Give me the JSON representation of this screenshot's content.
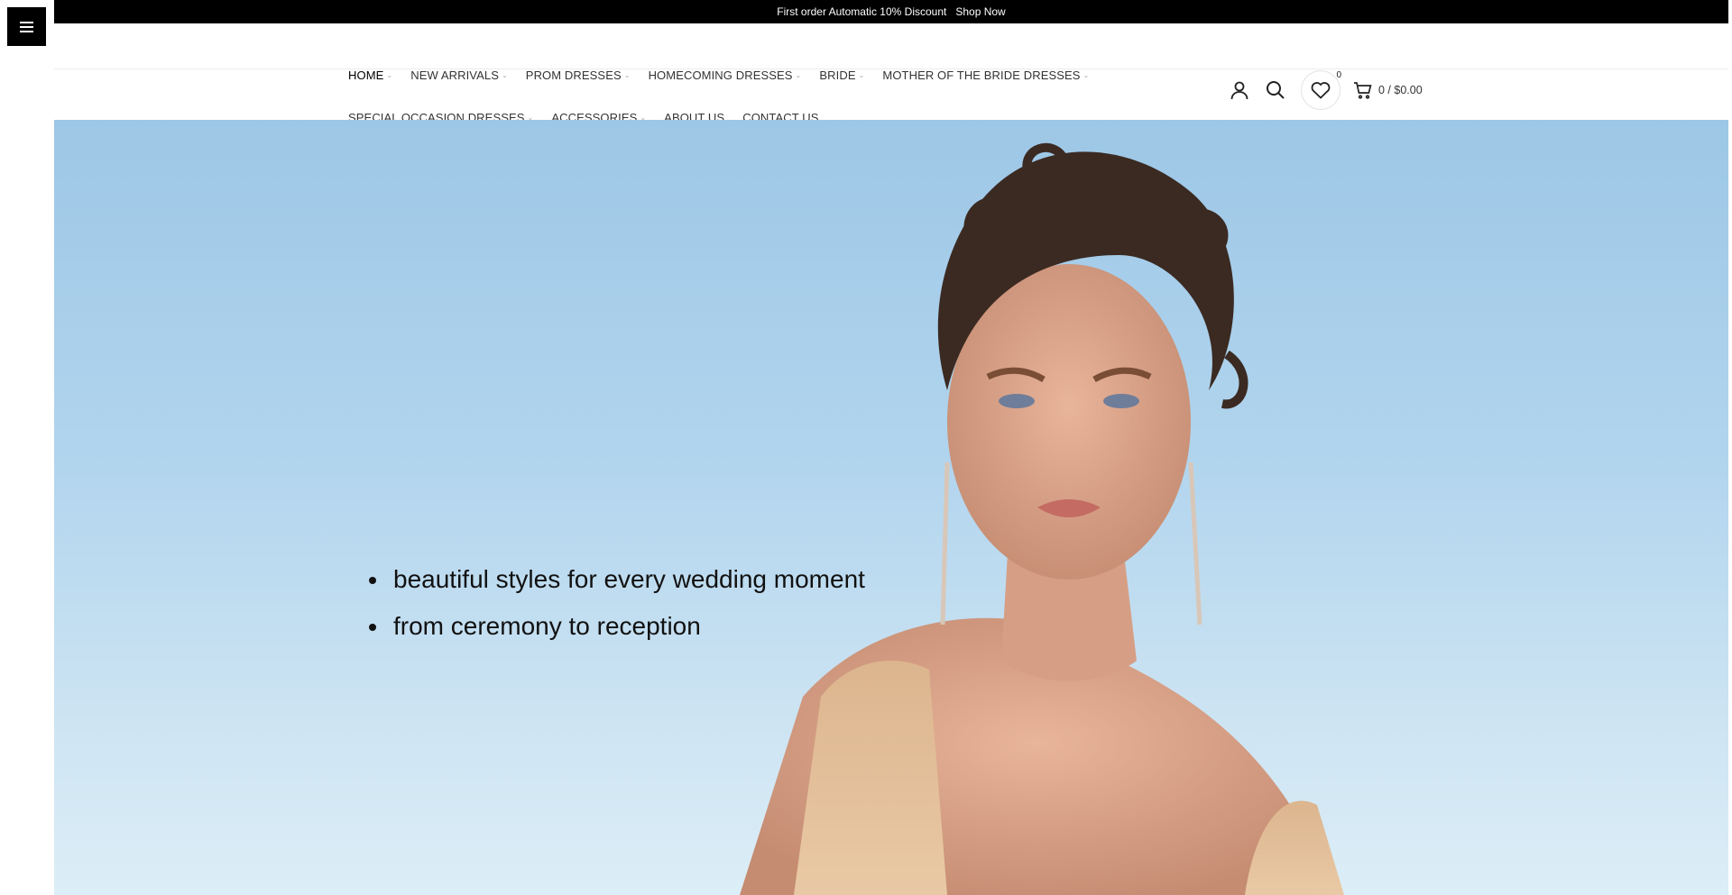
{
  "promo": {
    "text": "First order Automatic 10% Discount",
    "link": "Shop Now"
  },
  "nav": {
    "row1": [
      {
        "label": "HOME",
        "has_dropdown": true,
        "active": true
      },
      {
        "label": "NEW ARRIVALS",
        "has_dropdown": true
      },
      {
        "label": "PROM DRESSES",
        "has_dropdown": true
      },
      {
        "label": "HOMECOMING DRESSES",
        "has_dropdown": true
      },
      {
        "label": "BRIDE",
        "has_dropdown": true
      },
      {
        "label": "MOTHER OF THE BRIDE DRESSES",
        "has_dropdown": true
      }
    ],
    "row2": [
      {
        "label": "SPECIAL OCCASION DRESSES",
        "has_dropdown": true
      },
      {
        "label": "ACCESSORIES",
        "has_dropdown": true
      },
      {
        "label": "ABOUT US",
        "has_dropdown": false
      },
      {
        "label": "CONTACT US",
        "has_dropdown": false
      }
    ]
  },
  "header_icons": {
    "user": "user-icon",
    "search": "search-icon",
    "wishlist": "heart-icon",
    "wishlist_count": "0",
    "cart": "cart-icon",
    "cart_summary": "0 / $0.00"
  },
  "hero": {
    "lines": [
      "beautiful styles for every wedding moment",
      "from ceremony to reception"
    ]
  },
  "colors": {
    "promo_bg": "#000000",
    "sky_top": "#9dc7e6",
    "sky_bottom": "#dceef7"
  }
}
